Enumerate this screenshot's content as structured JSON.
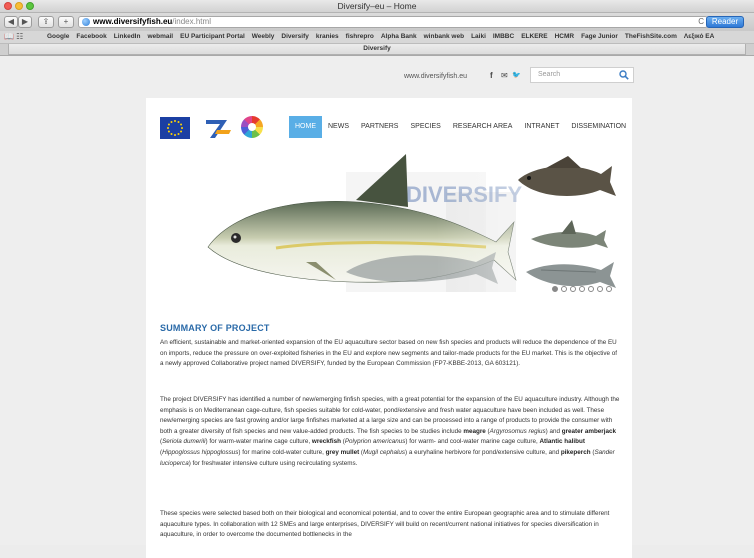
{
  "window": {
    "title": "Diversify–eu – Home"
  },
  "toolbar": {
    "back": "◀",
    "forward": "▶",
    "share": "⇪",
    "add_tab": "+",
    "url_domain": "www.diversifyfish.eu",
    "url_path": "/index.html",
    "reload": "C",
    "reader": "Reader"
  },
  "bookmarks": {
    "icons": "📖 ☷",
    "items": [
      "Google",
      "Facebook",
      "LinkedIn",
      "webmail",
      "EU Participant Portal",
      "Weebly",
      "Diversify",
      "kranies",
      "fishrepro",
      "Alpha Bank",
      "winbank web",
      "Laiki",
      "IMBBC",
      "ELKERE",
      "HCMR",
      "Fage Junior",
      "TheFishSite.com",
      "Λεξικό ΕΑ"
    ]
  },
  "tab": {
    "title": "Diversify"
  },
  "header": {
    "site_url": "www.diversifyfish.eu",
    "social": [
      "f",
      "✉",
      "🐦"
    ],
    "search_placeholder": "Search"
  },
  "nav": {
    "items": [
      "HOME",
      "NEWS",
      "PARTNERS",
      "SPECIES",
      "RESEARCH AREA",
      "INTRANET",
      "DISSEMINATION"
    ]
  },
  "banner": {
    "logo_text": "DIVERSIFY",
    "slide_count": 7
  },
  "summary": {
    "title": "SUMMARY OF PROJECT",
    "p1": "An efficient, sustainable and market-oriented expansion of the EU aquaculture sector based on new fish species and products will reduce the dependence of the EU on imports, reduce the pressure on over-exploited fisheries in the EU and explore new segments and tailor-made products for the EU market. This is the objective of a newly approved Collaborative project named DIVERSIFY, funded by the European Commission (FP7-KBBE-2013, GA 603121).",
    "p2_a": "The project DIVERSIFY has identified a number of new/emerging finfish species, with a great potential for the expansion of the EU aquaculture industry. Although the emphasis is on Mediterranean cage-culture, fish species suitable for cold-water, pond/extensive and fresh water aquaculture have been included as well. These new/emerging species are fast growing and/or large finfishes marketed at a large size and can be processed into a range of products to provide the consumer with both a greater diversity of fish species and new value-added products. The fish species to be studies include ",
    "s1": "meagre",
    "s1_latin": "Argyrosomus regius",
    "s2": "greater amberjack",
    "s2_latin": "Seriola dumerili",
    "p2_b": " for warm-water marine cage culture, ",
    "s3": "wreckfish",
    "s3_latin": "Polyprion americanus",
    "p2_c": " for warm- and cool-water marine cage culture, ",
    "s4": "Atlantic halibut",
    "s4_latin": "Hippoglossus hippoglossus",
    "p2_d": " for marine cold-water culture, ",
    "s5": "grey mullet",
    "s5_latin": "Mugil cephalus",
    "p2_e": " a euryhaline herbivore for pond/extensive culture, and ",
    "s6": "pikeperch",
    "s6_latin": "Sander lucioperca",
    "p2_f": " for freshwater intensive culture using recirculating systems.",
    "p3": "These species were selected based both on their biological and economical potential, and to cover the entire European geographic area and to stimulate different aquaculture types. In collaboration with 12 SMEs and large enterprises, DIVERSIFY will build on recent/current national initiatives for species diversification in aquaculture, in order to overcome the documented bottlenecks in the"
  }
}
